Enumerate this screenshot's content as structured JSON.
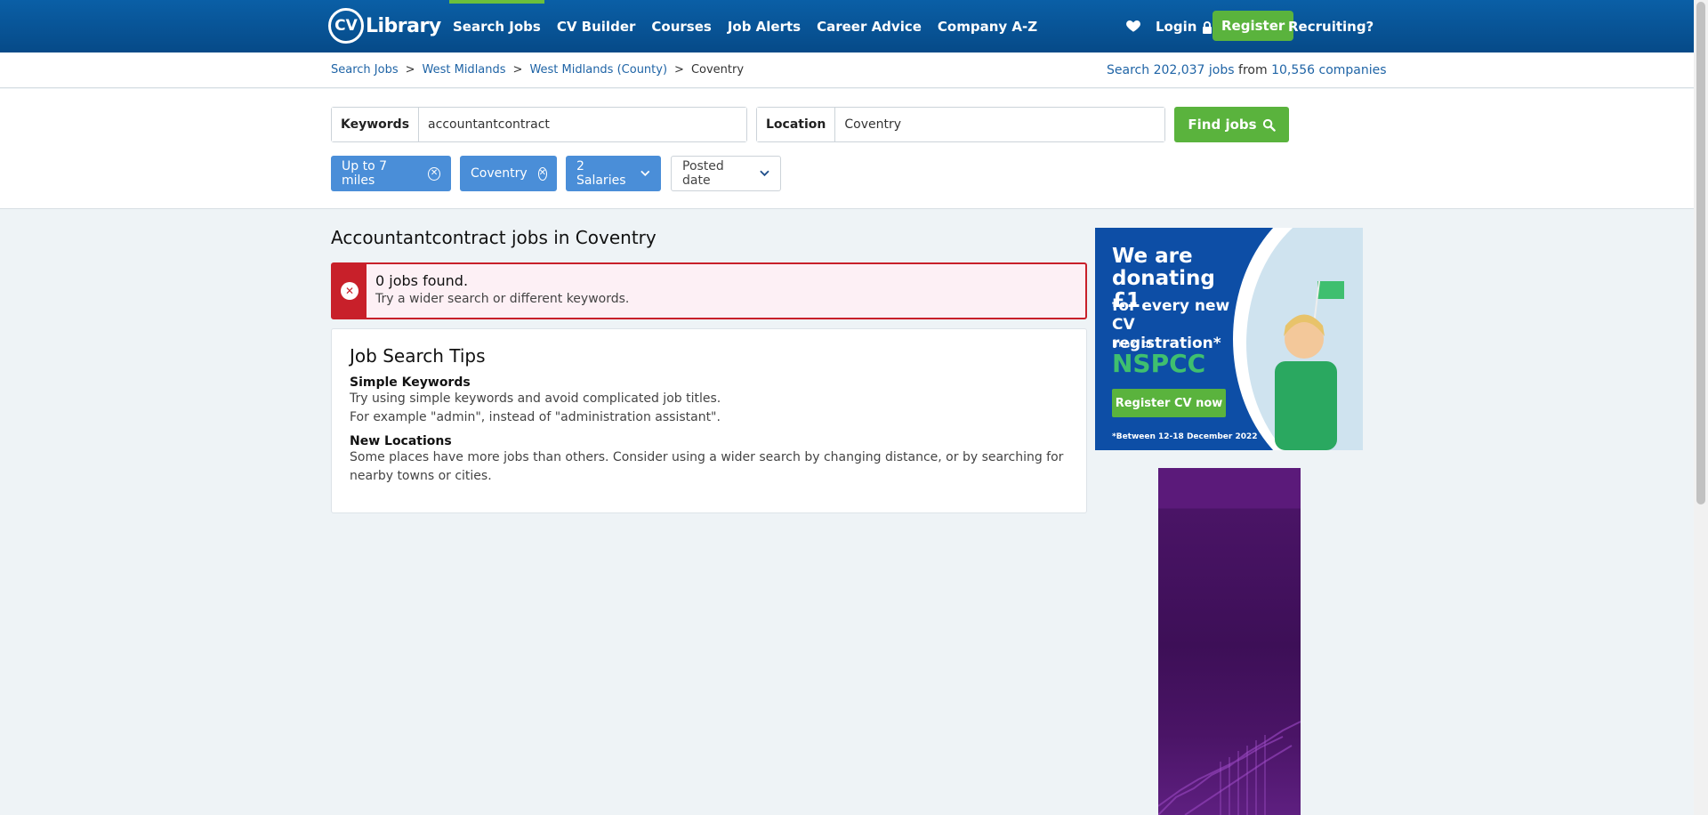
{
  "header": {
    "logo_text": "Library",
    "logo_badge": "CV",
    "nav": [
      "Search Jobs",
      "CV Builder",
      "Courses",
      "Job Alerts",
      "Career Advice",
      "Company A-Z"
    ],
    "login": "Login",
    "register": "Register",
    "recruiting": "Recruiting?"
  },
  "breadcrumb": {
    "items": [
      "Search Jobs",
      "West Midlands",
      "West Midlands (County)"
    ],
    "current": "Coventry",
    "stats_prefix": "Search",
    "jobs_count": "202,037",
    "jobs_word": "jobs",
    "from": "from",
    "companies_count": "10,556",
    "companies_word": "companies"
  },
  "search": {
    "keywords_label": "Keywords",
    "keywords_value": "accountantcontract",
    "location_label": "Location",
    "location_value": "Coventry",
    "find_button": "Find jobs"
  },
  "filters": {
    "distance": "Up to 7 miles",
    "location": "Coventry",
    "salaries": "2 Salaries",
    "posted": "Posted date"
  },
  "results": {
    "title": "Accountantcontract jobs in Coventry",
    "alert_heading": "0 jobs found.",
    "alert_text": "Try a wider search or different keywords."
  },
  "tips": {
    "heading": "Job Search Tips",
    "sections": [
      {
        "title": "Simple Keywords",
        "lines": [
          "Try using simple keywords and avoid complicated job titles.",
          "For example \"admin\", instead of \"administration assistant\"."
        ]
      },
      {
        "title": "New Locations",
        "lines": [
          "Some places have more jobs than others. Consider using a wider search by changing distance, or by searching for nearby towns or cities."
        ]
      }
    ]
  },
  "ad": {
    "line1": "We are donating £1",
    "line2": "for every new CV registration*",
    "line3": "In aid of",
    "brand": "NSPCC",
    "cta": "Register CV now",
    "fine": "*Between 12-18 December 2022"
  },
  "colors": {
    "header_blue": "#064a88",
    "accent_green": "#5ab33d",
    "chip_blue": "#4a8ed8",
    "error_red": "#c8202a"
  }
}
